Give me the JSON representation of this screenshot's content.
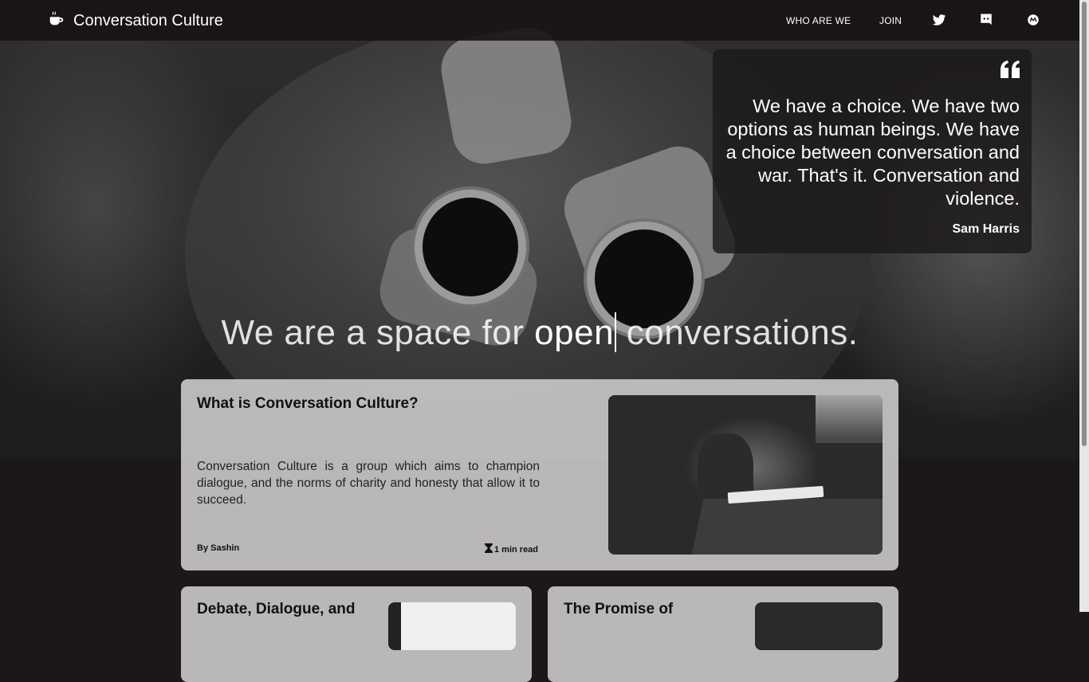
{
  "nav": {
    "brand_icon": "coffee-cup-icon",
    "brand_title": "Conversation Culture",
    "links": [
      "WHO ARE WE",
      "JOIN"
    ],
    "icons": [
      "twitter-icon",
      "discord-icon",
      "meetup-icon"
    ]
  },
  "hero": {
    "quote": {
      "icon": "quote-icon",
      "text": "We have a choice. We have two options as human beings. We have a choice between conversation and war. That's it. Conversation and violence.",
      "author": "Sam Harris"
    },
    "tagline": {
      "prefix": "We are a space for ",
      "highlight": "open",
      "suffix": " conversations."
    }
  },
  "cards": {
    "main": {
      "title": "What is Conversation Culture?",
      "description": "Conversation Culture is a group which aims to champion dialogue, and the norms of charity and honesty that allow it to succeed.",
      "author": "By Sashin",
      "read_icon": "hourglass-icon",
      "read_time": "1 min read"
    },
    "second": {
      "title": "Debate, Dialogue, and"
    },
    "third": {
      "title": "The Promise of"
    }
  },
  "colors": {
    "nav_bg": "#161215",
    "page_bg": "#1c171b",
    "card_bg": "#c6c4c6"
  }
}
